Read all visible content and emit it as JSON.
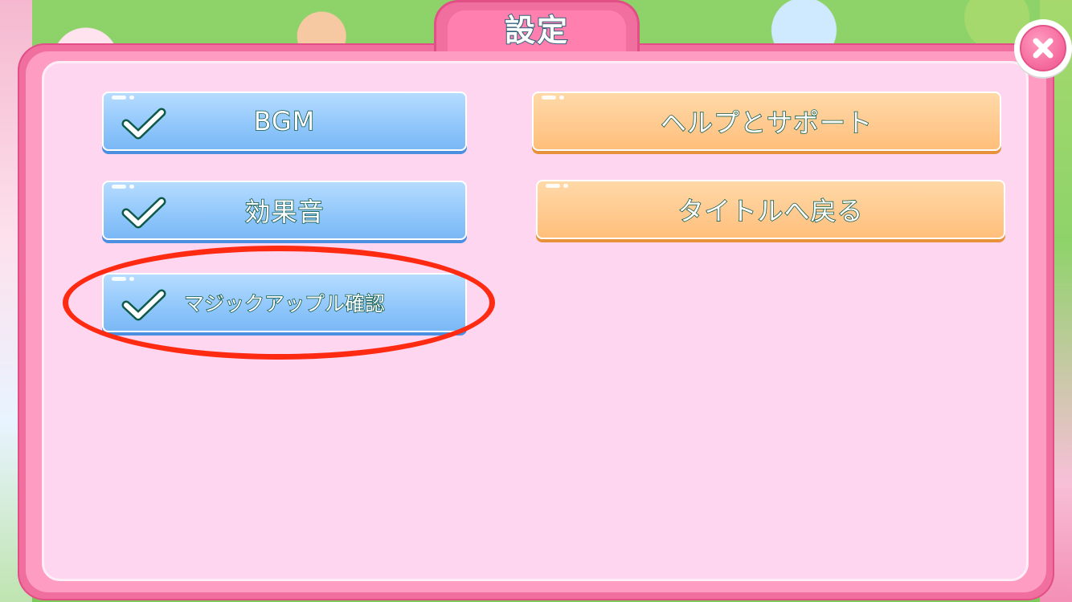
{
  "dialog": {
    "title": "設定",
    "close_icon": "close-x-icon"
  },
  "toggles": [
    {
      "label": "BGM",
      "checked": true,
      "icon": "checkmark-icon"
    },
    {
      "label": "効果音",
      "checked": true,
      "icon": "checkmark-icon"
    },
    {
      "label": "マジックアップル確認",
      "checked": true,
      "icon": "checkmark-icon"
    }
  ],
  "actions": [
    {
      "label": "ヘルプとサポート"
    },
    {
      "label": "タイトルへ戻る"
    }
  ],
  "colors": {
    "panel_pink": "#f06f9f",
    "panel_inner": "#ffd6ef",
    "toggle_blue": "#8fc6fb",
    "action_orange": "#ffc98e",
    "highlight_red": "#ff2a12",
    "text_outline": "#0f5a48"
  }
}
